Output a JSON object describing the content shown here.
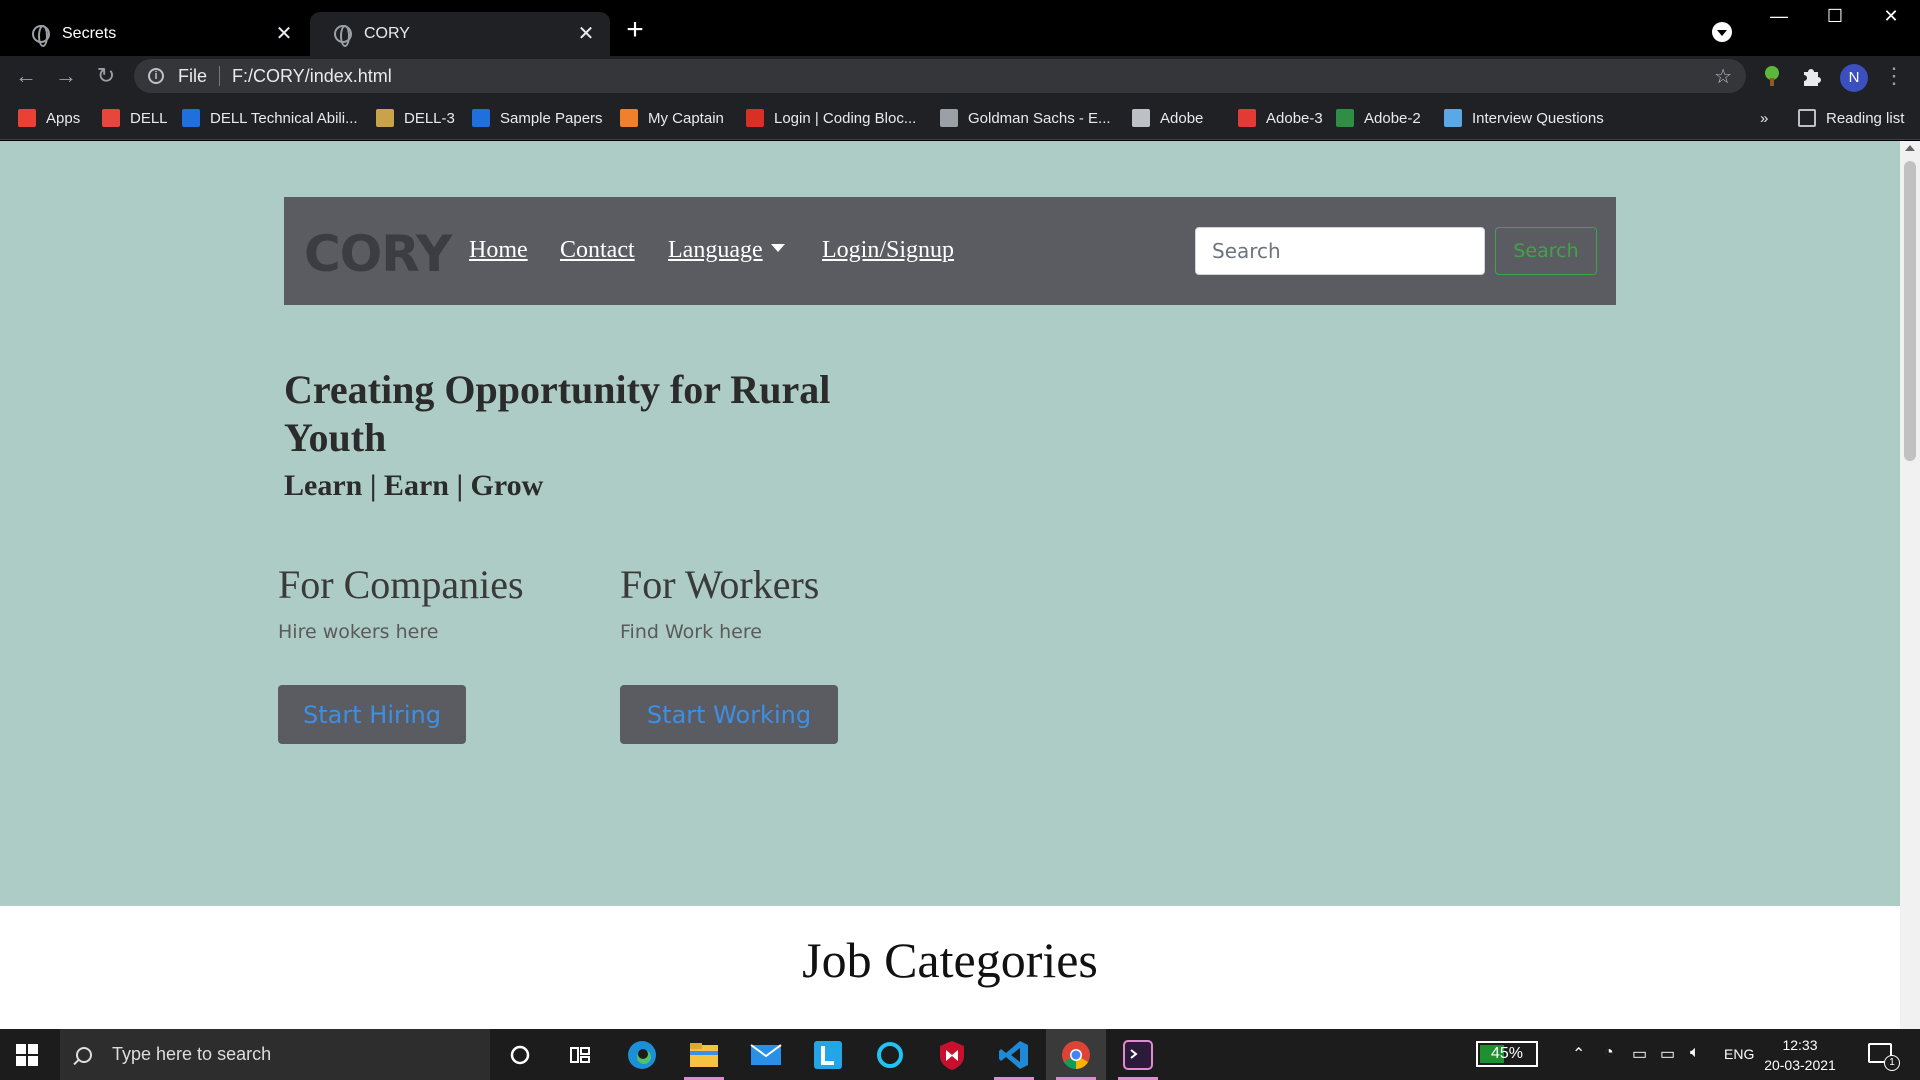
{
  "browser": {
    "tabs": [
      {
        "title": "Secrets"
      },
      {
        "title": "CORY"
      }
    ],
    "new_tab": "+",
    "address": {
      "scheme": "File",
      "url": "F:/CORY/index.html"
    },
    "profile_initial": "N",
    "bookmarks": [
      {
        "label": "Apps",
        "icon": "apps-grid-icon",
        "color": "#e94235"
      },
      {
        "label": "DELL",
        "icon": "dell-icon",
        "color": "#e8453c"
      },
      {
        "label": "DELL Technical Abili...",
        "icon": "y-icon",
        "color": "#1f6fde"
      },
      {
        "label": "DELL-3",
        "icon": "dell3-icon",
        "color": "#c9a24a"
      },
      {
        "label": "Sample Papers",
        "icon": "y-icon",
        "color": "#1f6fde"
      },
      {
        "label": "My Captain",
        "icon": "mycaptain-icon",
        "color": "#f0812a"
      },
      {
        "label": "Login | Coding Bloc...",
        "icon": "codingblocks-icon",
        "color": "#d93025"
      },
      {
        "label": "Goldman Sachs - E...",
        "icon": "mountain-icon",
        "color": "#9aa0a6"
      },
      {
        "label": "Adobe",
        "icon": "page-icon",
        "color": "#bdc1c6"
      },
      {
        "label": "Adobe-3",
        "icon": "vivaldi-icon",
        "color": "#e53935"
      },
      {
        "label": "Adobe-2",
        "icon": "gfg-icon",
        "color": "#2f8d46"
      },
      {
        "label": "Interview Questions",
        "icon": "ib-icon",
        "color": "#5aa9e6"
      }
    ],
    "more_bookmarks": "»",
    "reading_list": "Reading list"
  },
  "page": {
    "brand": "CORY",
    "nav": {
      "home": "Home",
      "contact": "Contact",
      "language": "Language",
      "login": "Login/Signup"
    },
    "search": {
      "placeholder": "Search",
      "button": "Search"
    },
    "headline": "Creating Opportunity for Rural Youth",
    "tagline": "Learn | Earn | Grow",
    "companies": {
      "title": "For Companies",
      "text": "Hire wokers here",
      "button": "Start Hiring"
    },
    "workers": {
      "title": "For Workers",
      "text": "Find Work here",
      "button": "Start Working"
    },
    "section_title": "Job Categories",
    "colors": {
      "hero_bg": "#adccc5",
      "navbar_bg": "#5a5c62",
      "accent_green": "#3fa447",
      "accent_blue": "#3d8fe6"
    }
  },
  "taskbar": {
    "search_placeholder": "Type here to search",
    "battery": "45%",
    "battery_level": 0.45,
    "language": "ENG",
    "time": "12:33",
    "date": "20-03-2021",
    "notification_count": "1"
  }
}
